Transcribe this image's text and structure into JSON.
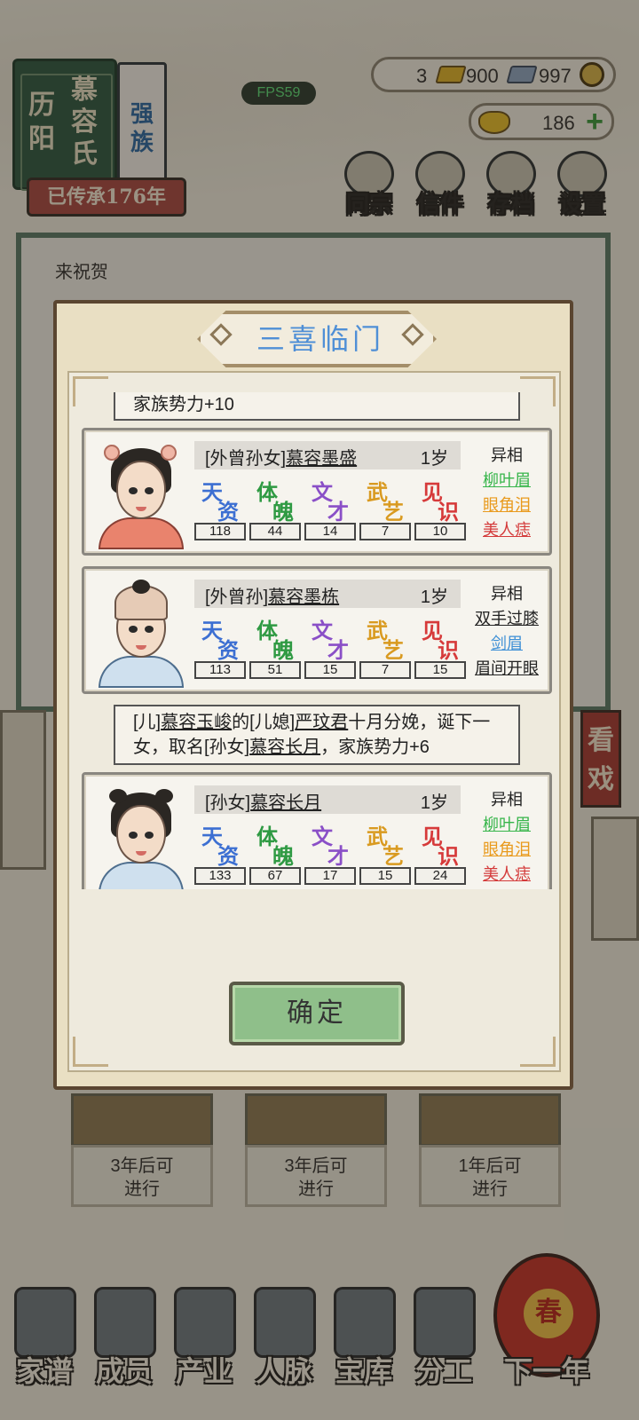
{
  "header": {
    "family_region": "历阳",
    "family_name": "慕容氏",
    "family_rank": "强族",
    "inherited": "已传承176年",
    "fps": "FPS59"
  },
  "currency": {
    "gold_bar": "3",
    "silver_bar": "900",
    "coins": "997",
    "ingots": "186"
  },
  "top_menu": [
    "同宗",
    "信件",
    "存档",
    "设置"
  ],
  "background_text": {
    "line1": "来祝贺"
  },
  "side_tag": "看戏",
  "later_cards": [
    {
      "text1": "3年后可",
      "text2": "进行"
    },
    {
      "text1": "3年后可",
      "text2": "进行"
    },
    {
      "text1": "1年后可",
      "text2": "进行"
    }
  ],
  "bottom_nav": [
    "家谱",
    "成员",
    "产业",
    "人脉",
    "宝库",
    "分工",
    "下一年"
  ],
  "lantern_char": "春",
  "modal": {
    "title": "三喜临门",
    "top_note": "家族势力+10",
    "confirm": "确定",
    "attr_labels": [
      "天资",
      "体魄",
      "文才",
      "武艺",
      "见识"
    ],
    "attr_colors": [
      "#3c6fd2",
      "#2f9a43",
      "#8a4fc7",
      "#d99a20",
      "#d63a3a"
    ],
    "yixiang_label": "异相",
    "cards": [
      {
        "relation": "[外曾孙女]",
        "name": "慕容墨盛",
        "age": "1岁",
        "stats": [
          "118",
          "44",
          "14",
          "7",
          "10"
        ],
        "traits": [
          {
            "t": "柳叶眉",
            "c": "#36b54a"
          },
          {
            "t": "眼角泪",
            "c": "#e99a1d"
          },
          {
            "t": "美人痣",
            "c": "#d43a3a"
          }
        ]
      },
      {
        "relation": "[外曾孙]",
        "name": "慕容墨栋",
        "age": "1岁",
        "stats": [
          "113",
          "51",
          "15",
          "7",
          "15"
        ],
        "traits": [
          {
            "t": "双手过膝",
            "c": "#222222"
          },
          {
            "t": "剑眉",
            "c": "#3d8fd6"
          },
          {
            "t": "眉间开眼",
            "c": "#222222"
          }
        ]
      },
      {
        "relation": "[孙女]",
        "name": "慕容长月",
        "age": "1岁",
        "stats": [
          "133",
          "67",
          "17",
          "15",
          "24"
        ],
        "traits": [
          {
            "t": "柳叶眉",
            "c": "#36b54a"
          },
          {
            "t": "眼角泪",
            "c": "#e99a1d"
          },
          {
            "t": "美人痣",
            "c": "#d43a3a"
          }
        ]
      }
    ],
    "birth_note": {
      "p1": "[儿]",
      "p2": "慕容玉峻",
      "p3": "的[儿媳]",
      "p4": "严玟君",
      "p5": "十月分娩，诞下一女，取名[孙女]",
      "p6": "慕容长月",
      "p7": "，家族势力+6"
    }
  }
}
